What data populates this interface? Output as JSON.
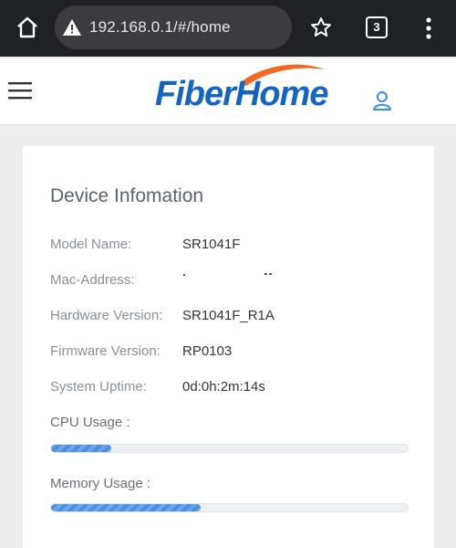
{
  "browser": {
    "url": "192.168.0.1/#/home",
    "tab_count": "3",
    "home_icon": "home-icon",
    "security_icon": "warning-triangle-icon",
    "bookmark_icon": "star-outline-icon",
    "menu_icon": "vertical-dots-icon"
  },
  "header": {
    "logo_text": "FiberHome",
    "menu_icon": "hamburger-icon",
    "user_icon": "user-icon",
    "brand_color": "#1565c0",
    "swoosh_color": "#f26722"
  },
  "device_info": {
    "title": "Device Infomation",
    "rows": [
      {
        "label": "Model Name:",
        "value": "SR1041F"
      },
      {
        "label": "Mac-Address:",
        "value": ""
      },
      {
        "label": "Hardware Version:",
        "value": "SR1041F_R1A"
      },
      {
        "label": "Firmware Version:",
        "value": "RP0103"
      },
      {
        "label": "System Uptime:",
        "value": "0d:0h:2m:14s"
      }
    ],
    "cpu": {
      "label": "CPU Usage :",
      "percent": 17
    },
    "memory": {
      "label": "Memory Usage :",
      "percent": 42
    },
    "progress_color": "#4a90e2"
  }
}
